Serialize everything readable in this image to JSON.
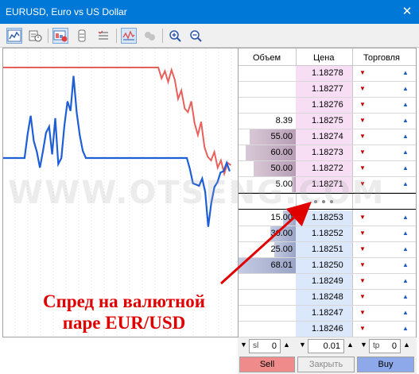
{
  "window": {
    "title": "EURUSD, Euro vs US Dollar",
    "close": "✕"
  },
  "toolbar": {
    "buttons": [
      "chart-line-icon",
      "tick-chart-icon",
      "market-depth-chart-icon",
      "depth-table-icon",
      "orders-list-icon",
      "trade-levels-icon",
      "hide-icon",
      "zoom-in-icon",
      "zoom-out-icon"
    ]
  },
  "columns": {
    "volume": "Объем",
    "price": "Цена",
    "trade": "Торговля"
  },
  "asks": [
    {
      "volume": "",
      "price": "1.18278",
      "fill": 0
    },
    {
      "volume": "",
      "price": "1.18277",
      "fill": 0
    },
    {
      "volume": "",
      "price": "1.18276",
      "fill": 0
    },
    {
      "volume": "8.39",
      "price": "1.18275",
      "fill": 0
    },
    {
      "volume": "55.00",
      "price": "1.18274",
      "fill": 0.81
    },
    {
      "volume": "60.00",
      "price": "1.18273",
      "fill": 0.88
    },
    {
      "volume": "50.00",
      "price": "1.18272",
      "fill": 0.74
    },
    {
      "volume": "5.00",
      "price": "1.18271",
      "fill": 0.07
    }
  ],
  "bids": [
    {
      "volume": "15.00",
      "price": "1.18253",
      "fill": 0.22
    },
    {
      "volume": "30.00",
      "price": "1.18252",
      "fill": 0.44
    },
    {
      "volume": "25.00",
      "price": "1.18251",
      "fill": 0.37
    },
    {
      "volume": "68.01",
      "price": "1.18250",
      "fill": 1.0
    },
    {
      "volume": "",
      "price": "1.18249",
      "fill": 0
    },
    {
      "volume": "",
      "price": "1.18248",
      "fill": 0
    },
    {
      "volume": "",
      "price": "1.18247",
      "fill": 0
    },
    {
      "volume": "",
      "price": "1.18246",
      "fill": 0
    }
  ],
  "controls": {
    "sl": {
      "label": "sl",
      "value": "0"
    },
    "volume": {
      "value": "0.01"
    },
    "tp": {
      "label": "tp",
      "value": "0"
    },
    "sell": "Sell",
    "close": "Закрыть",
    "buy": "Buy"
  },
  "annotation": {
    "line1": "Спред на валютной",
    "line2": "паре EUR/USD"
  },
  "watermark": "WWW.OTSENG.COM",
  "colors": {
    "ask_line": "#e8605c",
    "bid_line": "#1e5fd6",
    "ask_bg": "#f7def4",
    "bid_bg": "#dbe8fb",
    "annotation": "#e00000"
  },
  "chart_data": {
    "type": "line",
    "series": [
      {
        "values": [
          0,
          0,
          0,
          0,
          0,
          0,
          0,
          0,
          0,
          0,
          0,
          0,
          0,
          0,
          0,
          0,
          0,
          0,
          0,
          0,
          0,
          0,
          0,
          0,
          0,
          0,
          0,
          0,
          0,
          0,
          0,
          0,
          0,
          0,
          0,
          0,
          0,
          0,
          0,
          0,
          0,
          0,
          0,
          0,
          0,
          0,
          0,
          0,
          0,
          0,
          0,
          0,
          0,
          0,
          0,
          0,
          0,
          0,
          0,
          0,
          0,
          0,
          0,
          0,
          0,
          0,
          0,
          0,
          0,
          0,
          0,
          0,
          0,
          0,
          0,
          0,
          0,
          0,
          0,
          0,
          0,
          0,
          0,
          0,
          0,
          0,
          0,
          0,
          0,
          0,
          0,
          0,
          0,
          0,
          0,
          0,
          0,
          0,
          0,
          0,
          0,
          0,
          0,
          0,
          0,
          0,
          0,
          0,
          0,
          0,
          0,
          0,
          0,
          0,
          0,
          0,
          0,
          0,
          0,
          0,
          0,
          0,
          0,
          0,
          0,
          0,
          0,
          0,
          0,
          0,
          0,
          0,
          0,
          0,
          0,
          0,
          0,
          0,
          0,
          0,
          0,
          0,
          0,
          0,
          0,
          0,
          0,
          0,
          0,
          0,
          0,
          0,
          0,
          0
        ]
      },
      {
        "values": []
      }
    ],
    "ask": [
      0,
      0,
      0,
      0,
      0,
      0,
      0,
      0,
      0,
      0,
      0,
      0,
      0,
      0,
      0,
      0,
      0,
      0,
      0,
      0,
      0,
      0,
      0,
      0,
      0,
      0,
      0,
      0,
      0,
      0,
      0,
      0,
      0,
      0,
      0,
      0,
      0,
      0,
      0,
      0,
      0,
      0,
      0,
      0,
      0,
      0,
      0,
      0,
      -0.9,
      -0.3,
      -1.2,
      -0.2,
      -1.0,
      -2.6,
      -1.9,
      -3.4,
      -3.7,
      -2.8,
      -4.6,
      -5.6,
      -4.5,
      -6.6,
      -7.4,
      -7.7,
      -7.0,
      -8.3,
      -7.7,
      -8.8,
      -7.9,
      -8.1
    ],
    "bid": [
      -7.5,
      -7.5,
      -7.5,
      -7.5,
      -7.5,
      -7.5,
      -7.5,
      -7.5,
      -5.5,
      -4.0,
      -6.1,
      -7.0,
      -8.3,
      -6.9,
      -5.4,
      -4.9,
      -7.2,
      -4.2,
      -8.0,
      -7.5,
      -4.8,
      -2.8,
      -3.6,
      -0.7,
      -3.7,
      -5.6,
      -6.9,
      -7.5,
      -7.5,
      -7.5,
      -7.5,
      -7.5,
      -7.5,
      -7.5,
      -7.5,
      -7.5,
      -7.5,
      -7.5,
      -7.5,
      -7.5,
      -7.5,
      -7.5,
      -7.5,
      -7.5,
      -7.5,
      -7.5,
      -7.5,
      -7.5,
      -7.5,
      -7.5,
      -7.5,
      -7.5,
      -7.5,
      -7.5,
      -7.5,
      -7.5,
      -7.5,
      -7.5,
      -7.5,
      -7.5,
      -7.5,
      -8.4,
      -9.6,
      -9.7,
      -9.8,
      -9.2,
      -10.3,
      -13.2,
      -11.2,
      -9.9,
      -9.5,
      -8.7,
      -8.6,
      -7.9,
      -8.6
    ]
  }
}
